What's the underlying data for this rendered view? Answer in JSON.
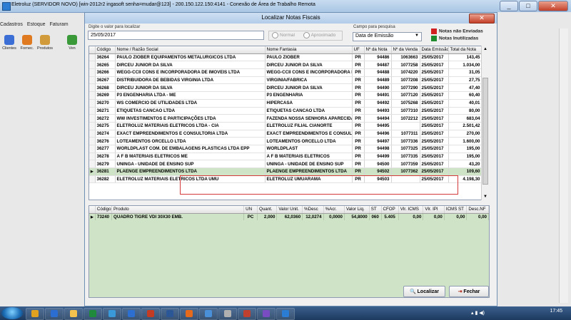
{
  "outer": {
    "title": "Eletroluz (SERVIDOR NOVO) [win-2012r2 ingasoft senha=mudar@123] - 200.150.122.150:4141 - Conexão de Área de Trabalho Remota"
  },
  "left": {
    "menu": [
      "Cadastros",
      "Estoque",
      "Faturam"
    ],
    "tools": [
      {
        "label": "Clientes",
        "color": "#3b6fd6"
      },
      {
        "label": "Fornec.",
        "color": "#e07a20"
      },
      {
        "label": "Produtos",
        "color": "#d19a3a"
      },
      {
        "label": "Ven",
        "color": "#3a9a3a"
      }
    ]
  },
  "dialog": {
    "title": "Localizar Notas Fiscais",
    "search_label": "Digite o valor para localizar",
    "search_value": "25/05/2017",
    "radio_normal": "Normal",
    "radio_aprox": "Aproximado",
    "field_label": "Campo para pesquisa",
    "field_value": "Data de Emissão",
    "legend_1": "Notas não Enviadas",
    "legend_2": "Notas Inutilizadas",
    "btn_localizar": "Localizar",
    "btn_fechar": "Fechar"
  },
  "grid1": {
    "headers": [
      "Código",
      "Nome / Razão Social",
      "Nome Fantasia",
      "UF",
      "Nº da Nota",
      "Nº da Venda",
      "Data Emissão",
      "Total da Nota"
    ],
    "rows": [
      [
        "36264",
        "PAULO ZIOBER EQUIPAMENTOS METALURGICOS LTDA",
        "PAULO ZIOBER",
        "PR",
        "94486",
        "1063663",
        "25/05/2017",
        "143,45"
      ],
      [
        "36265",
        "DIRCEU JUNIOR DA SILVA",
        "DIRCEU JUNIOR DA SILVA",
        "PR",
        "94487",
        "1077258",
        "25/05/2017",
        "1.034,00"
      ],
      [
        "36266",
        "WEGG-CCII CONS E INCORPORADORA DE IMOVEIS LTDA",
        "WEGG-CCII CONS E INCORPORADORA D",
        "PR",
        "94488",
        "1074220",
        "25/05/2017",
        "31,05"
      ],
      [
        "36267",
        "DISTRIBUIDORA DE BEBIDAS VIRGINIA LTDA",
        "VIRGINIA/FABRICA",
        "PR",
        "94489",
        "1077208",
        "25/05/2017",
        "27,75"
      ],
      [
        "36268",
        "DIRCEU JUNIOR DA SILVA",
        "DIRCEU JUNIOR DA SILVA",
        "PR",
        "94490",
        "1077290",
        "25/05/2017",
        "47,40"
      ],
      [
        "36269",
        "P3 ENGENHARIA LTDA - ME",
        "P3 ENGENHARIA",
        "PR",
        "94491",
        "1077120",
        "25/05/2017",
        "60,40"
      ],
      [
        "36270",
        "WS COMERCIO DE UTILIDADES LTDA",
        "HIPERCASA",
        "PR",
        "94492",
        "1075268",
        "25/05/2017",
        "40,01"
      ],
      [
        "36271",
        "ETIQUETAS CANCAO LTDA",
        "ETIQUETAS CANCAO LTDA",
        "PR",
        "94493",
        "1077310",
        "25/05/2017",
        "80,00"
      ],
      [
        "36272",
        "WW INVESTIMENTOS E PARTICIPAÇÕES LTDA",
        "FAZENDA NOSSA SENHORA APARECIDA",
        "PR",
        "94494",
        "1072212",
        "25/05/2017",
        "683,04"
      ],
      [
        "36275",
        "ELETROLUZ MATERIAIS ELETRICOS LTDA - CIA",
        "ELETROLUZ FILIAL CIANORTE",
        "PR",
        "94495",
        "",
        "25/05/2017",
        "2.501,42"
      ],
      [
        "36274",
        "EXACT EMPREENDIMENTOS E CONSULTORIA LTDA",
        "EXACT EMPREENDIMENTOS E CONSULT",
        "PR",
        "94496",
        "1077311",
        "25/05/2017",
        "270,00"
      ],
      [
        "36276",
        "LOTEAMENTOS ORCELLO LTDA",
        "LOTEAMENTOS ORCELLO LTDA",
        "PR",
        "94497",
        "1077336",
        "25/05/2017",
        "1.600,00"
      ],
      [
        "36277",
        "WORLDPLAST COM. DE EMBALAGENS PLASTICAS LTDA EPP",
        "WORLDPLAST",
        "PR",
        "94498",
        "1077325",
        "25/05/2017",
        "195,00"
      ],
      [
        "36278",
        "A F B MATERIAIS ELETRICOS ME",
        "A F B MATERIAIS ELETRICOS",
        "PR",
        "94499",
        "1077335",
        "25/05/2017",
        "195,00"
      ],
      [
        "36279",
        "UNINGA - UNIDADE DE ENSINO SUP",
        "UNINGA - UNIDADE DE ENSINO SUP",
        "PR",
        "94500",
        "1077359",
        "25/05/2017",
        "43,20"
      ],
      [
        "36281",
        "PLAENGE EMPREENDIMENTOS LTDA",
        "PLAENGE EMPREENDIMENTOS LTDA",
        "PR",
        "94502",
        "1077362",
        "25/05/2017",
        "109,60"
      ],
      [
        "36282",
        "ELETROLUZ MATERIAIS ELETRICOS LTDA UMU",
        "ELETROLUZ UMUARAMA",
        "PR",
        "94503",
        "",
        "25/05/2017",
        "4.198,30"
      ]
    ]
  },
  "grid2": {
    "headers": [
      "Código",
      "Produto",
      "UN",
      "Quant.",
      "Valor Unit.",
      "%Desc",
      "%Acr.",
      "Valor Liq.",
      "ST",
      "CFOP",
      "Vlr. ICMS",
      "Vlr. IPI",
      "ICMS ST",
      "Desc.NF"
    ],
    "rows": [
      [
        "73240",
        "QUADRO TIGRE VDI 30X30 EMB.",
        "PC",
        "2,000",
        "62,0360",
        "12,0274",
        "0,0000",
        "54,8000",
        "060",
        "5.405",
        "0,00",
        "0,00",
        "0,00",
        "0,00"
      ]
    ]
  },
  "taskbar": {
    "clock": "17:45",
    "apps": [
      {
        "color": "#e0a020"
      },
      {
        "color": "#2b6dd1"
      },
      {
        "color": "#f2c14e"
      },
      {
        "color": "#1f8a3b"
      },
      {
        "color": "#3a9ad9"
      },
      {
        "color": "#2d6fd0"
      },
      {
        "color": "#c23b22"
      },
      {
        "color": "#2b5797"
      },
      {
        "color": "#e66a1c"
      },
      {
        "color": "#4a90d9"
      },
      {
        "color": "#b0b0b0"
      },
      {
        "color": "#c04030"
      },
      {
        "color": "#7a4cc2"
      },
      {
        "color": "#2b7cd3"
      }
    ]
  }
}
